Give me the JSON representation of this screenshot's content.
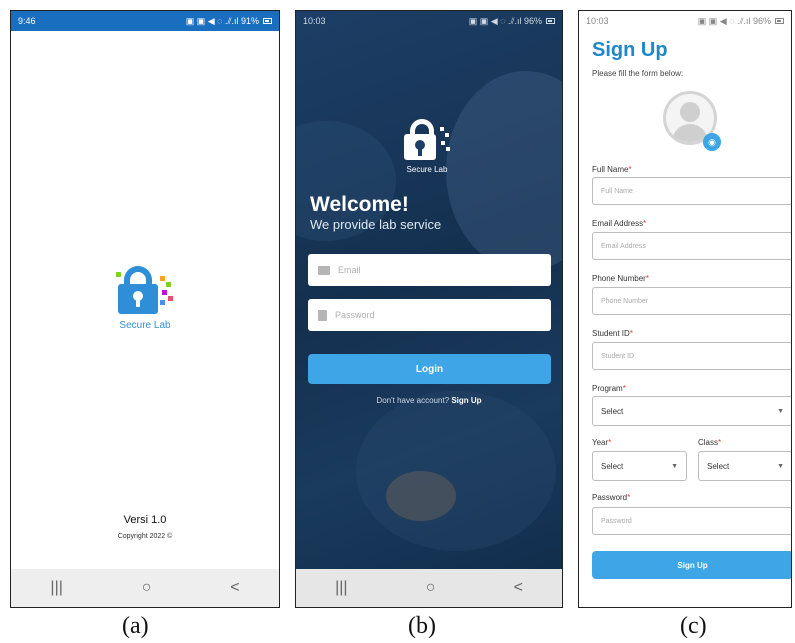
{
  "screens": {
    "a": {
      "status_time": "9:46",
      "status_right": "▣ ▣ ◀ ◌ .⫽.ıl 91%",
      "logo_text": "Secure Lab",
      "version": "Versi 1.0",
      "copyright": "Copyright 2022 ©",
      "caption": "(a)"
    },
    "b": {
      "status_time": "10:03",
      "status_right": "▣ ▣ ◀ ◌ .⫽.ıl 96%",
      "logo_text": "Secure Lab",
      "welcome": "Welcome!",
      "tagline": "We provide lab service",
      "email_placeholder": "Email",
      "password_placeholder": "Password",
      "login_label": "Login",
      "no_account": "Don't have account?",
      "signup_link": "Sign Up",
      "caption": "(b)"
    },
    "c": {
      "status_time": "10:03",
      "status_right": "▣ ▣ ◀ ◌ .⫽.ıl 96%",
      "title": "Sign Up",
      "subtitle": "Please fill the form below:",
      "full_name_label": "Full Name",
      "full_name_placeholder": "Full Name",
      "email_label": "Email Address",
      "email_placeholder": "Email Address",
      "phone_label": "Phone Number",
      "phone_placeholder": "Phone Number",
      "student_label": "Student ID",
      "student_placeholder": "Student ID",
      "program_label": "Program",
      "program_value": "Select",
      "year_label": "Year",
      "year_value": "Select",
      "class_label": "Class",
      "class_value": "Select",
      "password_label": "Password",
      "password_placeholder": "Password",
      "required_mark": "*",
      "signup_button": "Sign Up",
      "caption": "(c)"
    }
  },
  "nav": {
    "recents": "|||",
    "home": "○",
    "back": "<"
  },
  "colors": {
    "brand_blue": "#2e8fd8",
    "button_blue": "#3ea6e6",
    "login_bg": "#1d3e66",
    "required": "#e53935"
  }
}
